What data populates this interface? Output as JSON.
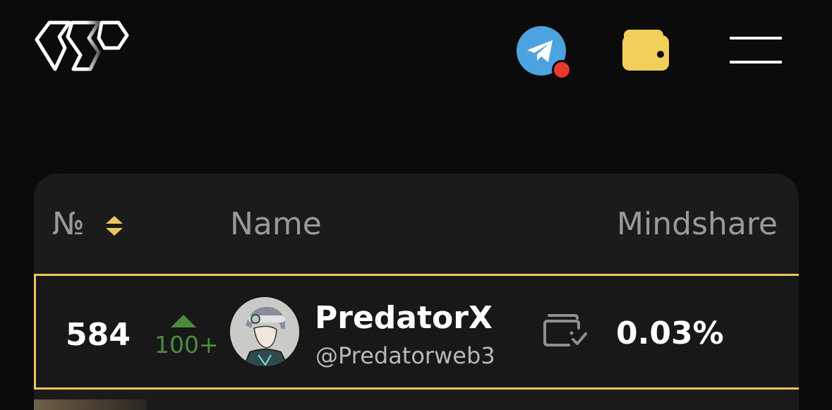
{
  "header": {
    "logo_icon": "wp-logo-icon",
    "telegram_icon": "telegram-icon",
    "notification_color": "#e8392c",
    "wallet_icon": "wallet-icon",
    "wallet_color": "#f0cf5a",
    "menu_icon": "hamburger-menu-icon"
  },
  "table": {
    "columns": {
      "rank": "№",
      "name": "Name",
      "mindshare": "Mindshare"
    },
    "sort_icon": "sort-icon",
    "highlight_color": "#ebc65a",
    "rows": [
      {
        "rank": "584",
        "change": "100+",
        "change_direction": "up",
        "change_color": "#4d8b3c",
        "name": "PredatorX",
        "handle": "@Predatorweb3",
        "wallet_verified_icon": "wallet-check-icon",
        "mindshare": "0.03%"
      }
    ]
  }
}
